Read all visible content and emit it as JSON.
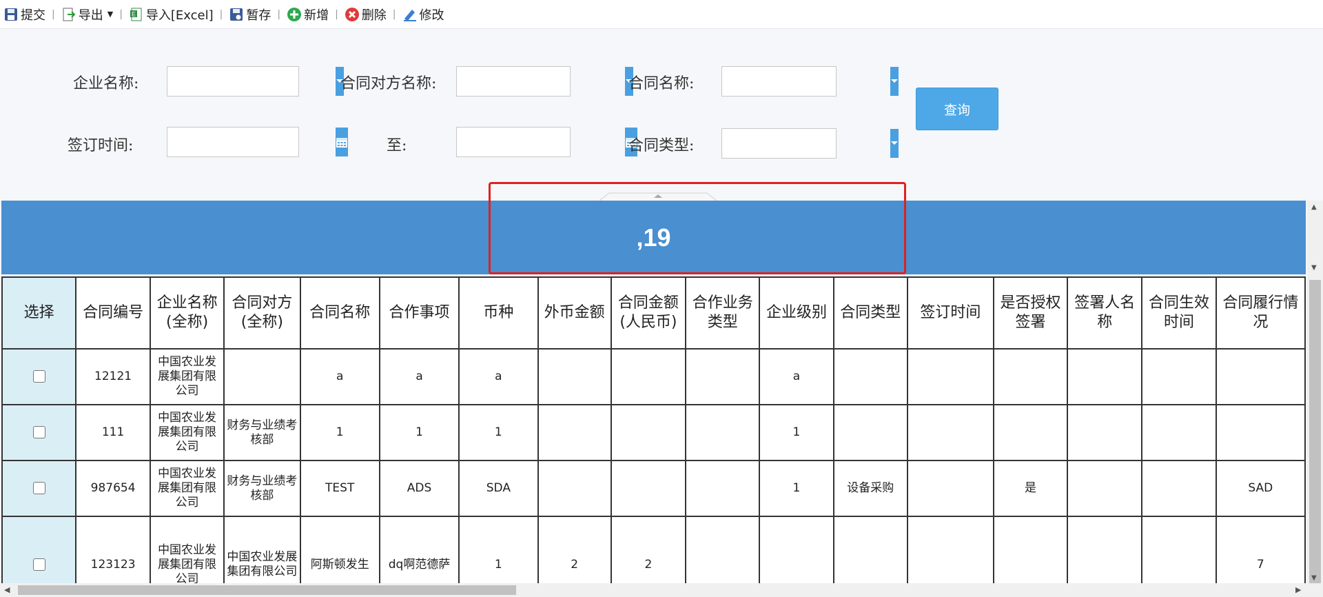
{
  "toolbar": {
    "submit": "提交",
    "export": "导出",
    "import_excel": "导入[Excel]",
    "save_draft": "暂存",
    "add": "新增",
    "delete": "删除",
    "edit": "修改",
    "separator": "|"
  },
  "filters": {
    "company_name_label": "企业名称:",
    "counterparty_label": "合同对方名称:",
    "contract_name_label": "合同名称:",
    "sign_date_label": "签订时间:",
    "to_label": "至:",
    "contract_type_label": "合同类型:",
    "company_name_value": "",
    "counterparty_value": "",
    "contract_name_value": "",
    "sign_date_from": "",
    "sign_date_to": "",
    "contract_type_value": "",
    "query_button": "查询"
  },
  "banner": {
    "text": ",19"
  },
  "table": {
    "headers": [
      "选择",
      "合同编号",
      "企业名称(全称)",
      "合同对方(全称)",
      "合同名称",
      "合作事项",
      "币种",
      "外币金额",
      "合同金额(人民币)",
      "合作业务类型",
      "企业级别",
      "合同类型",
      "签订时间",
      "是否授权签署",
      "签署人名称",
      "合同生效时间",
      "合同履行情况"
    ],
    "rows": [
      [
        "",
        "12121",
        "中国农业发展集团有限公司",
        "",
        "a",
        "a",
        "a",
        "",
        "",
        "",
        "a",
        "",
        "",
        "",
        "",
        "",
        ""
      ],
      [
        "",
        "111",
        "中国农业发展集团有限公司",
        "财务与业绩考核部",
        "1",
        "1",
        "1",
        "",
        "",
        "",
        "1",
        "",
        "",
        "",
        "",
        "",
        ""
      ],
      [
        "",
        "987654",
        "中国农业发展集团有限公司",
        "财务与业绩考核部",
        "TEST",
        "ADS",
        "SDA",
        "",
        "",
        "",
        "1",
        "设备采购",
        "",
        "是",
        "",
        "",
        "SAD"
      ],
      [
        "",
        "123123",
        "中国农业发展集团有限公司",
        "中国农业发展集团有限公司",
        "阿斯顿发生",
        "dq啊范德萨",
        "1",
        "2",
        "2",
        "",
        "",
        "",
        "",
        "",
        "",
        "",
        "7"
      ]
    ]
  },
  "colors": {
    "banner": "#4a8fcf",
    "accent": "#4a9fe0",
    "highlight": "#e02020",
    "select_column": "#daeef6"
  }
}
